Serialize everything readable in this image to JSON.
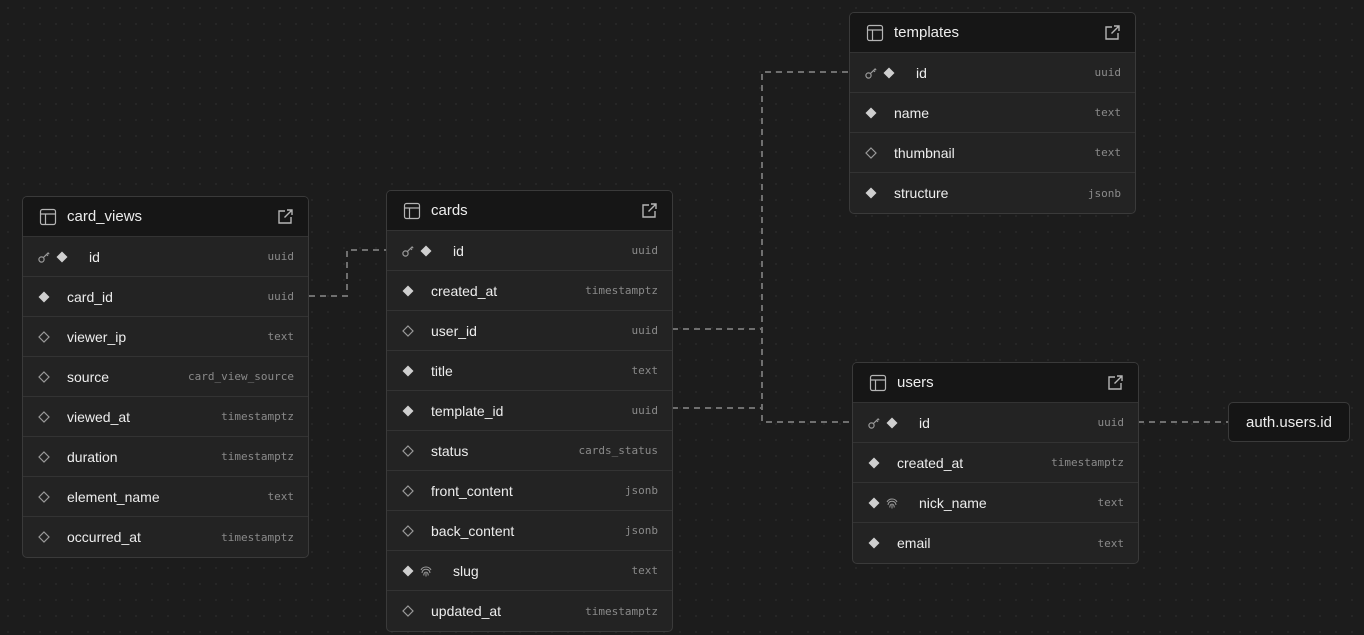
{
  "tables": [
    {
      "key": "card_views",
      "name": "card_views",
      "columns": [
        {
          "name": "id",
          "type": "uuid",
          "pk": true,
          "filled": true,
          "unique": false
        },
        {
          "name": "card_id",
          "type": "uuid",
          "pk": false,
          "filled": true,
          "unique": false
        },
        {
          "name": "viewer_ip",
          "type": "text",
          "pk": false,
          "filled": false,
          "unique": false
        },
        {
          "name": "source",
          "type": "card_view_source",
          "pk": false,
          "filled": false,
          "unique": false
        },
        {
          "name": "viewed_at",
          "type": "timestamptz",
          "pk": false,
          "filled": false,
          "unique": false
        },
        {
          "name": "duration",
          "type": "timestamptz",
          "pk": false,
          "filled": false,
          "unique": false
        },
        {
          "name": "element_name",
          "type": "text",
          "pk": false,
          "filled": false,
          "unique": false
        },
        {
          "name": "occurred_at",
          "type": "timestamptz",
          "pk": false,
          "filled": false,
          "unique": false
        }
      ]
    },
    {
      "key": "cards",
      "name": "cards",
      "columns": [
        {
          "name": "id",
          "type": "uuid",
          "pk": true,
          "filled": true,
          "unique": false
        },
        {
          "name": "created_at",
          "type": "timestamptz",
          "pk": false,
          "filled": true,
          "unique": false
        },
        {
          "name": "user_id",
          "type": "uuid",
          "pk": false,
          "filled": false,
          "unique": false
        },
        {
          "name": "title",
          "type": "text",
          "pk": false,
          "filled": true,
          "unique": false
        },
        {
          "name": "template_id",
          "type": "uuid",
          "pk": false,
          "filled": true,
          "unique": false
        },
        {
          "name": "status",
          "type": "cards_status",
          "pk": false,
          "filled": false,
          "unique": false
        },
        {
          "name": "front_content",
          "type": "jsonb",
          "pk": false,
          "filled": false,
          "unique": false
        },
        {
          "name": "back_content",
          "type": "jsonb",
          "pk": false,
          "filled": false,
          "unique": false
        },
        {
          "name": "slug",
          "type": "text",
          "pk": false,
          "filled": true,
          "unique": true
        },
        {
          "name": "updated_at",
          "type": "timestamptz",
          "pk": false,
          "filled": false,
          "unique": false
        }
      ]
    },
    {
      "key": "templates",
      "name": "templates",
      "columns": [
        {
          "name": "id",
          "type": "uuid",
          "pk": true,
          "filled": true,
          "unique": false
        },
        {
          "name": "name",
          "type": "text",
          "pk": false,
          "filled": true,
          "unique": false
        },
        {
          "name": "thumbnail",
          "type": "text",
          "pk": false,
          "filled": false,
          "unique": false
        },
        {
          "name": "structure",
          "type": "jsonb",
          "pk": false,
          "filled": true,
          "unique": false
        }
      ]
    },
    {
      "key": "users",
      "name": "users",
      "columns": [
        {
          "name": "id",
          "type": "uuid",
          "pk": true,
          "filled": true,
          "unique": false
        },
        {
          "name": "created_at",
          "type": "timestamptz",
          "pk": false,
          "filled": true,
          "unique": false
        },
        {
          "name": "nick_name",
          "type": "text",
          "pk": false,
          "filled": true,
          "unique": true
        },
        {
          "name": "email",
          "type": "text",
          "pk": false,
          "filled": true,
          "unique": false
        }
      ]
    }
  ],
  "external_ref": "auth.users.id",
  "colors": {
    "background": "#1c1c1c",
    "table_bg": "#232323",
    "header_bg": "#161616",
    "border": "#3a3a3a",
    "edge": "#6f6f6f",
    "text": "#ededed",
    "type_text": "#8a8a8a"
  }
}
